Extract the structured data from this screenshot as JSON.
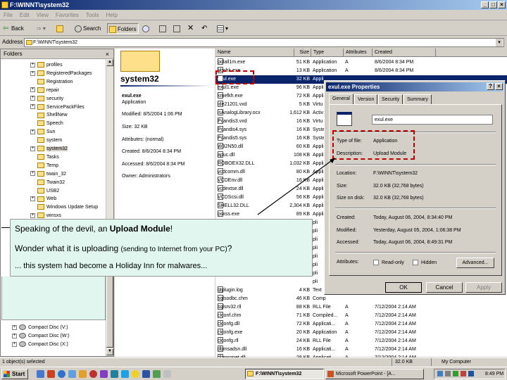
{
  "window": {
    "title": "F:\\WINNT\\system32"
  },
  "menu": [
    "File",
    "Edit",
    "View",
    "Favorites",
    "Tools",
    "Help"
  ],
  "toolbar": {
    "back": "Back",
    "search": "Search",
    "folders": "Folders"
  },
  "address": {
    "label": "Address",
    "value": "F:\\WINNT\\system32"
  },
  "folders": {
    "title": "Folders",
    "items": [
      "profiles",
      "RegisteredPackages",
      "Registration",
      "repair",
      "security",
      "ServicePackFiles",
      "ShellNew",
      "Speech",
      "Sun",
      "system",
      "system32",
      "Tasks",
      "Temp",
      "twain_32",
      "Twain32",
      "USB2",
      "Web",
      "Windows Update Setup",
      "winsxs"
    ],
    "drives": [
      "Compact Disc (V:)",
      "Compact Disc (W:)",
      "Compact Disc (X:)"
    ]
  },
  "info": {
    "folder_title": "system32",
    "file_name": "exul.exe",
    "file_type": "Application",
    "modified": "Modified: 8/5/2004 1:06 PM",
    "size": "Size: 32 KB",
    "attributes": "Attributes: (normal)",
    "created": "Created: 8/6/2004 8:34 PM",
    "accessed": "Accessed: 8/6/2004 8:34 PM",
    "owner": "Owner: Administrators"
  },
  "list": {
    "columns": [
      "Name",
      "Size",
      "Type",
      "Attributes",
      "Created"
    ],
    "rows": [
      {
        "name": "polall1m.exe",
        "size": "51 KB",
        "type": "Application",
        "attr": "A",
        "created": "8/6/2004 8:34 PM"
      },
      {
        "name": "bbohk.exe",
        "size": "13 KB",
        "type": "Application",
        "attr": "A",
        "created": "8/6/2004 8:34 PM"
      },
      {
        "name": "exul.exe",
        "size": "32 KB",
        "type": "Appli",
        "attr": "",
        "created": ""
      },
      {
        "name": "exul1.exe",
        "size": "96 KB",
        "type": "Appli",
        "attr": "",
        "created": ""
      },
      {
        "name": "kmefkh.exe",
        "size": "72 KB",
        "type": "Appli",
        "attr": "",
        "created": ""
      },
      {
        "name": "ide21201.vxd",
        "size": "5 KB",
        "type": "Virtu",
        "attr": "",
        "created": ""
      },
      {
        "name": "isAnalogLibrary.ocx",
        "size": "1,612 KB",
        "type": "Activ",
        "attr": "",
        "created": ""
      },
      {
        "name": "Pcandis3.vxd",
        "size": "16 KB",
        "type": "Virtu",
        "attr": "",
        "created": ""
      },
      {
        "name": "Pcandis4.sys",
        "size": "16 KB",
        "type": "Syste",
        "attr": "",
        "created": ""
      },
      {
        "name": "Pcandis5.sys",
        "size": "16 KB",
        "type": "Syste",
        "attr": "",
        "created": ""
      },
      {
        "name": "W32N50.dll",
        "size": "60 KB",
        "type": "Appli",
        "attr": "",
        "created": ""
      },
      {
        "name": "apuc.dll",
        "size": "108 KB",
        "type": "Appli",
        "attr": "",
        "created": ""
      },
      {
        "name": "ROBOEX32.DLL",
        "size": "1,032 KB",
        "type": "Appli",
        "attr": "",
        "created": ""
      },
      {
        "name": "vcdcomm.dll",
        "size": "80 KB",
        "type": "Appli",
        "attr": "",
        "created": ""
      },
      {
        "name": "VCDEnv.dll",
        "size": "16 KB",
        "type": "Appli",
        "attr": "",
        "created": ""
      },
      {
        "name": "vcdextse.dll",
        "size": "24 KB",
        "type": "Appli",
        "attr": "",
        "created": ""
      },
      {
        "name": "VCDScsi.dll",
        "size": "56 KB",
        "type": "Appli",
        "attr": "",
        "created": ""
      },
      {
        "name": "SHELL32.DLL",
        "size": "2,304 KB",
        "type": "Appli",
        "attr": "",
        "created": ""
      },
      {
        "name": "psxss.exe",
        "size": "89 KB",
        "type": "Appli",
        "attr": "",
        "created": ""
      },
      {
        "name": "qtplugin.log",
        "size": "4 KB",
        "type": "Text",
        "attr": "",
        "created": ""
      },
      {
        "name": "sqlsodbc.chm",
        "size": "46 KB",
        "type": "Comp",
        "attr": "",
        "created": ""
      },
      {
        "name": "sqlsrv32.rll",
        "size": "88 KB",
        "type": "RLL File",
        "attr": "A",
        "created": "7/12/2004 2:14 AM"
      },
      {
        "name": "clconf.chm",
        "size": "71 KB",
        "type": "Compiled...",
        "attr": "A",
        "created": "7/12/2004 2:14 AM"
      },
      {
        "name": "clconfg.dll",
        "size": "72 KB",
        "type": "Applicati...",
        "attr": "A",
        "created": "7/12/2004 2:14 AM"
      },
      {
        "name": "clconfg.exe",
        "size": "20 KB",
        "type": "Application",
        "attr": "A",
        "created": "7/12/2004 2:14 AM"
      },
      {
        "name": "clconfg.rll",
        "size": "24 KB",
        "type": "RLL File",
        "attr": "A",
        "created": "7/12/2004 2:14 AM"
      },
      {
        "name": "dbmsadsn.dll",
        "size": "16 KB",
        "type": "Applicati...",
        "attr": "A",
        "created": "7/12/2004 2:14 AM"
      },
      {
        "name": "dbmsgnet.dll",
        "size": "28 KB",
        "type": "Applicati...",
        "attr": "A",
        "created": "7/12/2004 2:14 AM"
      }
    ],
    "hidden_rows_prefix": [
      "pli",
      "pli",
      "pli",
      "pli",
      "pli",
      "pli",
      "pli",
      "pli"
    ]
  },
  "dialog": {
    "title": "exul.exe Properties",
    "tabs": [
      "General",
      "Version",
      "Security",
      "Summary"
    ],
    "filename": "exul.exe",
    "type_label": "Type of file:",
    "type_value": "Application",
    "desc_label": "Description:",
    "desc_value": "Upload Module",
    "location_label": "Location:",
    "location_value": "F:\\WINNT\\system32",
    "size_label": "Size:",
    "size_value": "32.0 KB (32,768 bytes)",
    "disk_label": "Size on disk:",
    "disk_value": "32.0 KB (32,768 bytes)",
    "created_label": "Created:",
    "created_value": "Today, August 06, 2004, 8:34:40 PM",
    "modified_label": "Modified:",
    "modified_value": "Yesterday, August 05, 2004, 1:06:38 PM",
    "accessed_label": "Accessed:",
    "accessed_value": "Today, August 06, 2004, 8:49:31 PM",
    "attr_label": "Attributes:",
    "readonly": "Read-only",
    "hidden": "Hidden",
    "advanced": "Advanced...",
    "ok": "OK",
    "cancel": "Cancel",
    "apply": "Apply"
  },
  "callout": {
    "line1_pre": "Speaking of the devil, an ",
    "line1_bold": "Upload Module",
    "line1_post": "!",
    "line2_pre": "Wonder what it is uploading ",
    "line2_small": "(sending to Internet from your PC)",
    "line2_post": "?",
    "line3": "... this system had become a Holiday Inn for malwares..."
  },
  "status": {
    "left": "1 object(s) selected",
    "size": "32.0 KB",
    "zone": "My Computer"
  },
  "taskbar": {
    "start": "Start",
    "task1": "F:\\WINNT\\system32",
    "task2": "Microsoft PowerPoint - [A...",
    "clock": "8:49 PM"
  },
  "colors": {
    "titlebar": "#0a246a",
    "highlight": "#c00000",
    "callout_bg": "#e0f6ee"
  }
}
